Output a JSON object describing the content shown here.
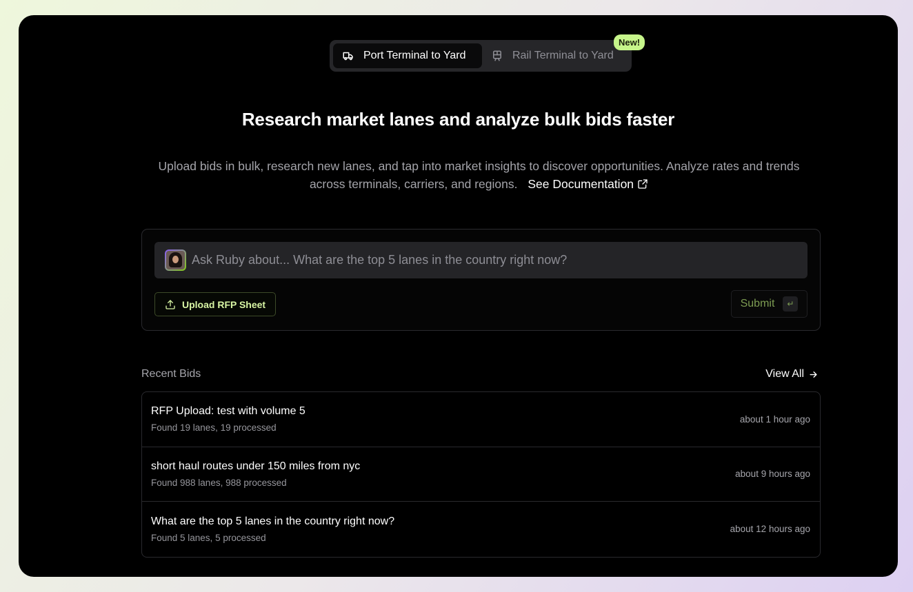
{
  "toggle": {
    "options": [
      {
        "label": "Port Terminal to Yard",
        "icon": "truck-icon",
        "active": true
      },
      {
        "label": "Rail Terminal to Yard",
        "icon": "train-icon",
        "active": false
      }
    ],
    "badge": "New!"
  },
  "hero": {
    "title": "Research market lanes and analyze bulk bids faster",
    "description": "Upload bids in bulk, research new lanes, and tap into market insights to discover opportunities. Analyze rates and trends across terminals, carriers, and regions.",
    "doc_link": "See Documentation"
  },
  "ask": {
    "placeholder": "Ask Ruby about... What are the top 5 lanes in the country right now?",
    "value": "",
    "upload_label": "Upload RFP Sheet",
    "submit_label": "Submit",
    "submit_key": "↵"
  },
  "recent": {
    "title": "Recent Bids",
    "view_all": "View All",
    "items": [
      {
        "title": "RFP Upload: test with volume 5",
        "sub": "Found 19 lanes, 19 processed",
        "time": "about 1 hour ago"
      },
      {
        "title": "short haul routes under 150 miles from nyc",
        "sub": "Found 988 lanes, 988 processed",
        "time": "about 9 hours ago"
      },
      {
        "title": "What are the top 5 lanes in the country right now?",
        "sub": "Found 5 lanes, 5 processed",
        "time": "about 12 hours ago"
      }
    ]
  },
  "colors": {
    "accent": "#c6f58a",
    "background": "#000000",
    "card_border": "#2a2a2e"
  }
}
